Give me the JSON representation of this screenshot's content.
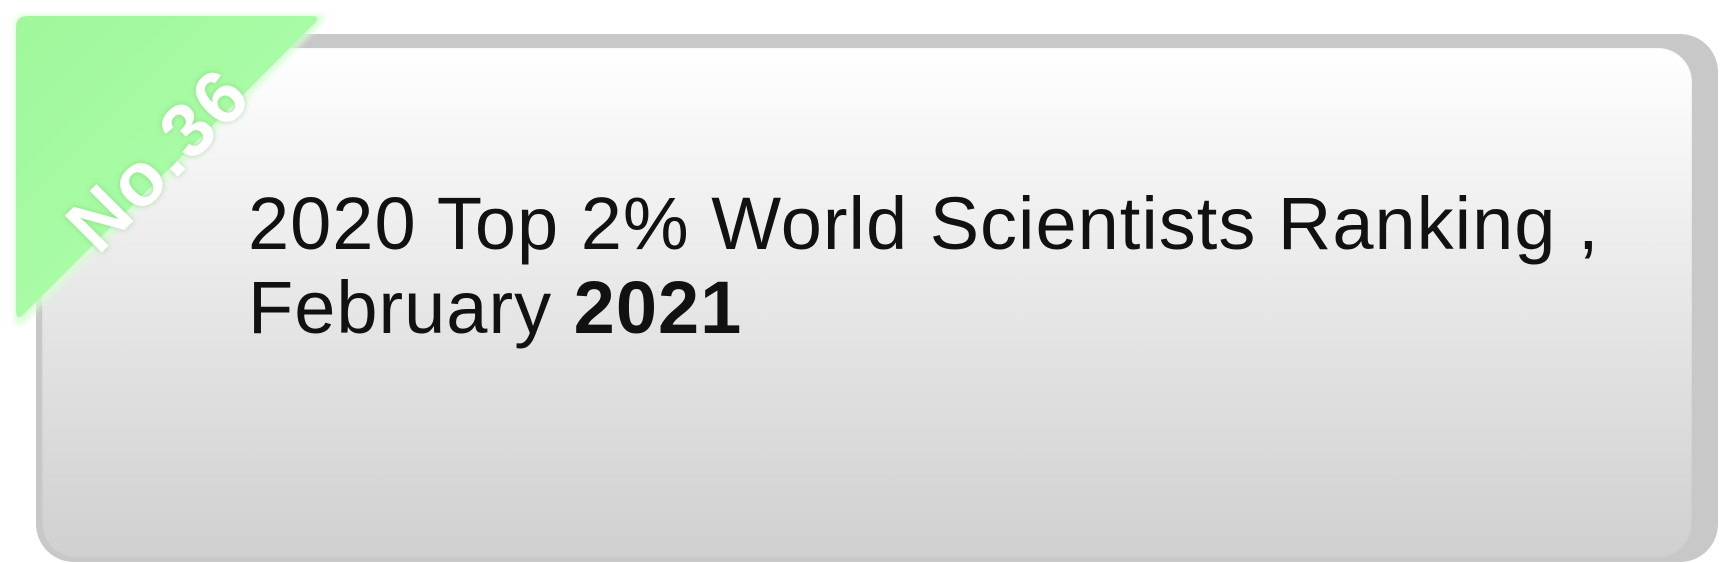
{
  "badge": {
    "label": "No.36",
    "color": "#a3fca0"
  },
  "headline": {
    "line1": "2020 Top 2% World Scientists Ranking ,",
    "line2_prefix": "February ",
    "line2_year": "2021"
  }
}
